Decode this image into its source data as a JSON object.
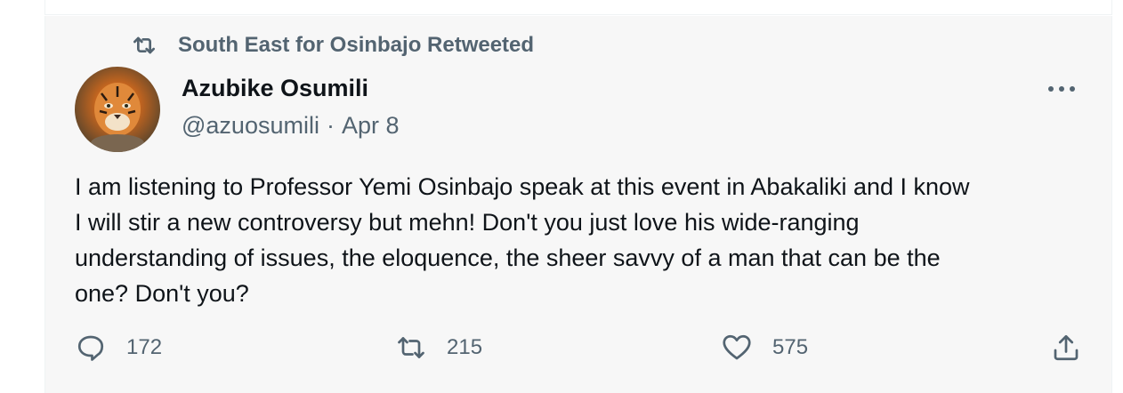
{
  "retweet": {
    "text": "South East for Osinbajo Retweeted",
    "icon": "retweet-icon"
  },
  "author": {
    "name": "Azubike Osumili",
    "handle": "@azuosumili",
    "separator": "·",
    "date": "Apr 8"
  },
  "tweet": {
    "lines": [
      "I am listening to Professor Yemi Osinbajo speak at this event in Abakaliki and I know",
      "I will stir a new controversy but mehn! Don't you just love his wide-ranging",
      "understanding of issues, the eloquence, the sheer savvy of a man that can be the",
      "one? Don't you?"
    ]
  },
  "actions": {
    "replies": "172",
    "retweets": "215",
    "likes": "575"
  },
  "colors": {
    "secondary_text": "#536471",
    "primary_text": "#0f1419",
    "background": "#f7f7f7"
  }
}
